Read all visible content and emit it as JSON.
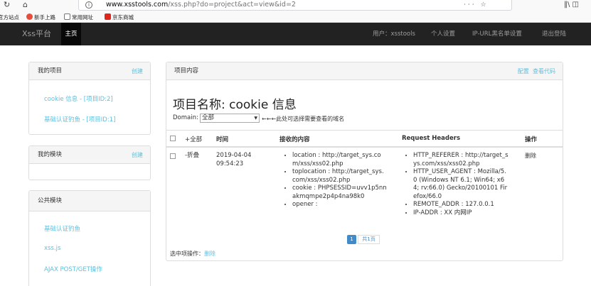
{
  "browser": {
    "url_host": "www.xsstools.com",
    "url_path": "/xss.php?do=project&act=view&id=2",
    "tools": "··· ☆",
    "bookmarks": [
      "官方站点",
      "新手上路",
      "常用网址",
      "京东商城"
    ]
  },
  "navbar": {
    "brand": "Xss平台",
    "home": "主页",
    "user": "用户：xsstools",
    "settings": "个人设置",
    "blacklist": "IP-URL黑名单设置",
    "logout": "退出登陆"
  },
  "sidebar": {
    "projects": {
      "title": "我的项目",
      "action": "创建",
      "items": [
        "cookie 信息 - [项目ID:2]",
        "基础认证钓鱼 - [项目ID:1]"
      ]
    },
    "modules": {
      "title": "我的模块",
      "action": "创建"
    },
    "public": {
      "title": "公共模块",
      "items": [
        "基础认证钓鱼",
        "xss.js",
        "AJAX POST/GET操作"
      ]
    }
  },
  "content": {
    "panel_title": "项目内容",
    "config": "配置",
    "view_code": "查看代码",
    "project_name": "项目名称: cookie 信息",
    "domain_label": "Domain:",
    "domain_value": "全部",
    "domain_hint": "←←←此处可选择需要查看的域名",
    "columns": {
      "toggle": "+全部",
      "time": "时间",
      "content": "接收的内容",
      "headers": "Request Headers",
      "action": "操作"
    },
    "row": {
      "toggle": "-折叠",
      "date": "2019-04-04",
      "time": "09:54:23",
      "content": [
        "location : http://target_sys.com/xss/xss02.php",
        "toplocation : http://target_sys.com/xss/xss02.php",
        "cookie : PHPSESSID=uvv1p5nnakmqmpe2p4p4na98k0",
        "opener :"
      ],
      "headers": [
        "HTTP_REFERER : http://target_sys.com/xss/xss02.php",
        "HTTP_USER_AGENT : Mozilla/5.0 (Windows NT 6.1; Win64; x64; rv:66.0) Gecko/20100101 Firefox/66.0",
        "REMOTE_ADDR : 127.0.0.1",
        "IP-ADDR : XX 内网IP"
      ],
      "delete": "删除"
    },
    "pager": {
      "current": "1",
      "total": "共1页"
    },
    "batch_label": "选中项操作：",
    "batch_delete": "删除"
  }
}
